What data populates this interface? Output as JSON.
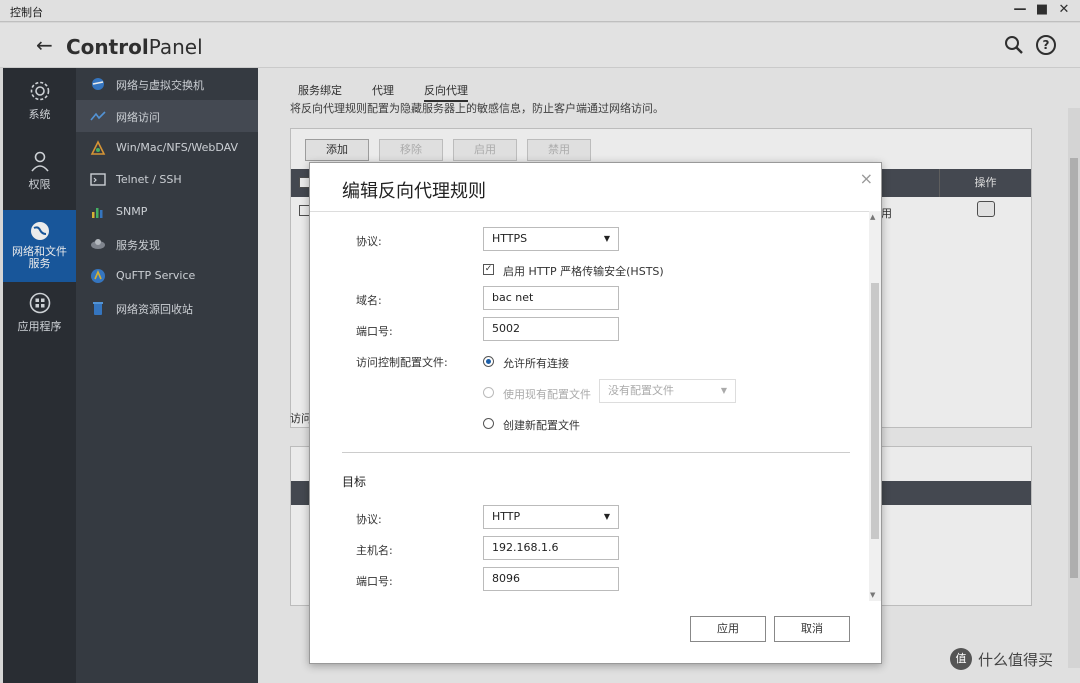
{
  "window": {
    "title": "控制台",
    "controls": [
      "—",
      "■",
      "✕"
    ]
  },
  "header": {
    "brand_pre": "Control",
    "brand_post": "Panel"
  },
  "rail": [
    {
      "label": "系统",
      "icon": "gear-icon"
    },
    {
      "label": "权限",
      "icon": "user-icon"
    },
    {
      "label": "网络和文件服务",
      "icon": "globe-icon",
      "active": true
    },
    {
      "label": "应用程序",
      "icon": "apps-icon"
    }
  ],
  "submenu": [
    {
      "label": "网络与虚拟交换机",
      "icon": "network-switch-icon"
    },
    {
      "label": "网络访问",
      "icon": "network-access-icon",
      "active": true
    },
    {
      "label": "Win/Mac/NFS/WebDAV",
      "icon": "file-share-icon"
    },
    {
      "label": "Telnet / SSH",
      "icon": "terminal-icon"
    },
    {
      "label": "SNMP",
      "icon": "snmp-icon"
    },
    {
      "label": "服务发现",
      "icon": "discovery-icon"
    },
    {
      "label": "QuFTP Service",
      "icon": "ftp-icon"
    },
    {
      "label": "网络资源回收站",
      "icon": "recycle-bin-icon"
    }
  ],
  "tabs": [
    "服务绑定",
    "代理",
    "反向代理"
  ],
  "main": {
    "description": "将反向代理规则配置为隐藏服务器上的敏感信息，防止客户端通过网络访问。",
    "toolbar": {
      "add": "添加",
      "remove": "移除",
      "enable": "启用",
      "disable": "禁用"
    },
    "op_header": "操作",
    "row_text": "用",
    "section2_label": "访问"
  },
  "modal": {
    "title": "编辑反向代理规则",
    "close": "×",
    "source": {
      "protocol_label": "协议:",
      "protocol_value": "HTTPS",
      "hsts_label": "启用 HTTP 严格传输安全(HSTS)",
      "hsts_checked": true,
      "domain_label": "域名:",
      "domain_value": "bac              net",
      "port_label": "端口号:",
      "port_value": "5002",
      "acl_label": "访问控制配置文件:",
      "acl_allow_all": "允许所有连接",
      "acl_use_existing": "使用现有配置文件",
      "acl_existing_value": "没有配置文件",
      "acl_create_new": "创建新配置文件"
    },
    "target": {
      "section_title": "目标",
      "protocol_label": "协议:",
      "protocol_value": "HTTP",
      "host_label": "主机名:",
      "host_value": "192.168.1.6",
      "port_label": "端口号:",
      "port_value": "8096"
    },
    "buttons": {
      "apply": "应用",
      "cancel": "取消"
    }
  },
  "watermark": {
    "logo": "值",
    "text": "什么值得买"
  },
  "colors": {
    "accent": "#1b5ea8",
    "rail": "#2d3138",
    "submenu": "#3a3f47"
  }
}
